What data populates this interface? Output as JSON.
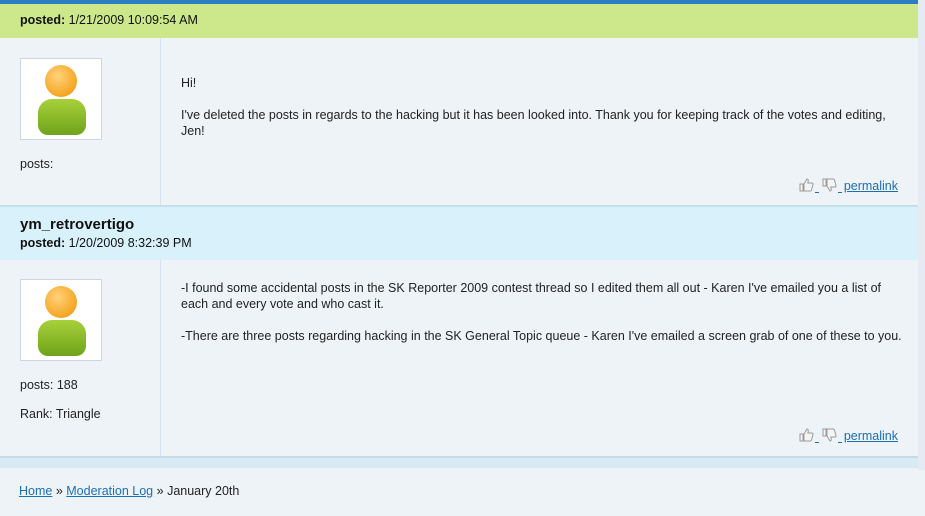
{
  "post1": {
    "posted_label": "posted:",
    "posted_date": "1/21/2009 10:09:54 AM",
    "posts_label": "posts:",
    "posts_count": "",
    "message": [
      "Hi!",
      "I've deleted the posts in regards to the hacking but it has been looked into. Thank you for keeping track of the votes and editing, Jen!"
    ],
    "permalink_label": "permalink"
  },
  "post2": {
    "username": "ym_retrovertigo",
    "posted_label": "posted:",
    "posted_date": "1/20/2009 8:32:39 PM",
    "posts_label": "posts:",
    "posts_count": "188",
    "rank_label": "Rank:",
    "rank_value": "Triangle",
    "message": [
      "-I found some accidental posts in the SK Reporter 2009 contest thread so I edited them all out - Karen I've emailed you a list of each and every vote and who cast it.",
      "-There are three posts regarding hacking in the SK General Topic queue - Karen I've emailed a screen grab of one of these to you."
    ],
    "permalink_label": "permalink"
  },
  "breadcrumb": {
    "home": "Home",
    "separator": "»",
    "moderation_log": "Moderation Log",
    "current": "January 20th"
  },
  "icons": {
    "thumbs_up": "thumbs-up-icon",
    "thumbs_down": "thumbs-down-icon",
    "avatar": "default-user-avatar"
  },
  "colors": {
    "post_header_green": "#cde88a",
    "post_header_blue": "#d8f1fb",
    "link": "#1a6fb3",
    "top_bar": "#2b7fc1"
  }
}
